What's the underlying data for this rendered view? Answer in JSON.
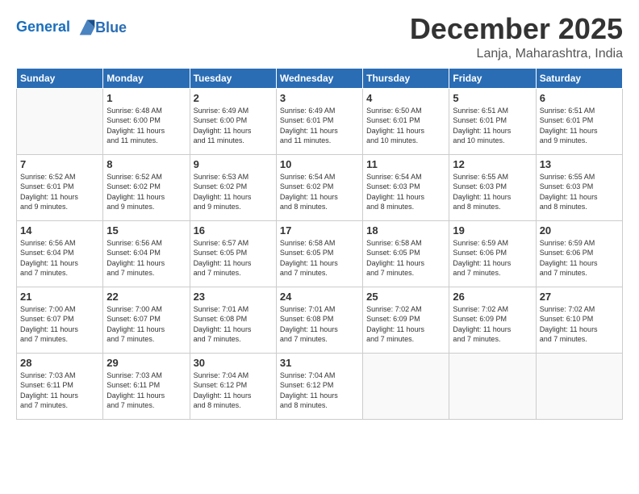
{
  "header": {
    "logo_line1": "General",
    "logo_line2": "Blue",
    "title": "December 2025",
    "location": "Lanja, Maharashtra, India"
  },
  "columns": [
    "Sunday",
    "Monday",
    "Tuesday",
    "Wednesday",
    "Thursday",
    "Friday",
    "Saturday"
  ],
  "weeks": [
    [
      {
        "day": "",
        "info": ""
      },
      {
        "day": "1",
        "info": "Sunrise: 6:48 AM\nSunset: 6:00 PM\nDaylight: 11 hours\nand 11 minutes."
      },
      {
        "day": "2",
        "info": "Sunrise: 6:49 AM\nSunset: 6:00 PM\nDaylight: 11 hours\nand 11 minutes."
      },
      {
        "day": "3",
        "info": "Sunrise: 6:49 AM\nSunset: 6:01 PM\nDaylight: 11 hours\nand 11 minutes."
      },
      {
        "day": "4",
        "info": "Sunrise: 6:50 AM\nSunset: 6:01 PM\nDaylight: 11 hours\nand 10 minutes."
      },
      {
        "day": "5",
        "info": "Sunrise: 6:51 AM\nSunset: 6:01 PM\nDaylight: 11 hours\nand 10 minutes."
      },
      {
        "day": "6",
        "info": "Sunrise: 6:51 AM\nSunset: 6:01 PM\nDaylight: 11 hours\nand 9 minutes."
      }
    ],
    [
      {
        "day": "7",
        "info": "Sunrise: 6:52 AM\nSunset: 6:01 PM\nDaylight: 11 hours\nand 9 minutes."
      },
      {
        "day": "8",
        "info": "Sunrise: 6:52 AM\nSunset: 6:02 PM\nDaylight: 11 hours\nand 9 minutes."
      },
      {
        "day": "9",
        "info": "Sunrise: 6:53 AM\nSunset: 6:02 PM\nDaylight: 11 hours\nand 9 minutes."
      },
      {
        "day": "10",
        "info": "Sunrise: 6:54 AM\nSunset: 6:02 PM\nDaylight: 11 hours\nand 8 minutes."
      },
      {
        "day": "11",
        "info": "Sunrise: 6:54 AM\nSunset: 6:03 PM\nDaylight: 11 hours\nand 8 minutes."
      },
      {
        "day": "12",
        "info": "Sunrise: 6:55 AM\nSunset: 6:03 PM\nDaylight: 11 hours\nand 8 minutes."
      },
      {
        "day": "13",
        "info": "Sunrise: 6:55 AM\nSunset: 6:03 PM\nDaylight: 11 hours\nand 8 minutes."
      }
    ],
    [
      {
        "day": "14",
        "info": "Sunrise: 6:56 AM\nSunset: 6:04 PM\nDaylight: 11 hours\nand 7 minutes."
      },
      {
        "day": "15",
        "info": "Sunrise: 6:56 AM\nSunset: 6:04 PM\nDaylight: 11 hours\nand 7 minutes."
      },
      {
        "day": "16",
        "info": "Sunrise: 6:57 AM\nSunset: 6:05 PM\nDaylight: 11 hours\nand 7 minutes."
      },
      {
        "day": "17",
        "info": "Sunrise: 6:58 AM\nSunset: 6:05 PM\nDaylight: 11 hours\nand 7 minutes."
      },
      {
        "day": "18",
        "info": "Sunrise: 6:58 AM\nSunset: 6:05 PM\nDaylight: 11 hours\nand 7 minutes."
      },
      {
        "day": "19",
        "info": "Sunrise: 6:59 AM\nSunset: 6:06 PM\nDaylight: 11 hours\nand 7 minutes."
      },
      {
        "day": "20",
        "info": "Sunrise: 6:59 AM\nSunset: 6:06 PM\nDaylight: 11 hours\nand 7 minutes."
      }
    ],
    [
      {
        "day": "21",
        "info": "Sunrise: 7:00 AM\nSunset: 6:07 PM\nDaylight: 11 hours\nand 7 minutes."
      },
      {
        "day": "22",
        "info": "Sunrise: 7:00 AM\nSunset: 6:07 PM\nDaylight: 11 hours\nand 7 minutes."
      },
      {
        "day": "23",
        "info": "Sunrise: 7:01 AM\nSunset: 6:08 PM\nDaylight: 11 hours\nand 7 minutes."
      },
      {
        "day": "24",
        "info": "Sunrise: 7:01 AM\nSunset: 6:08 PM\nDaylight: 11 hours\nand 7 minutes."
      },
      {
        "day": "25",
        "info": "Sunrise: 7:02 AM\nSunset: 6:09 PM\nDaylight: 11 hours\nand 7 minutes."
      },
      {
        "day": "26",
        "info": "Sunrise: 7:02 AM\nSunset: 6:09 PM\nDaylight: 11 hours\nand 7 minutes."
      },
      {
        "day": "27",
        "info": "Sunrise: 7:02 AM\nSunset: 6:10 PM\nDaylight: 11 hours\nand 7 minutes."
      }
    ],
    [
      {
        "day": "28",
        "info": "Sunrise: 7:03 AM\nSunset: 6:11 PM\nDaylight: 11 hours\nand 7 minutes."
      },
      {
        "day": "29",
        "info": "Sunrise: 7:03 AM\nSunset: 6:11 PM\nDaylight: 11 hours\nand 7 minutes."
      },
      {
        "day": "30",
        "info": "Sunrise: 7:04 AM\nSunset: 6:12 PM\nDaylight: 11 hours\nand 8 minutes."
      },
      {
        "day": "31",
        "info": "Sunrise: 7:04 AM\nSunset: 6:12 PM\nDaylight: 11 hours\nand 8 minutes."
      },
      {
        "day": "",
        "info": ""
      },
      {
        "day": "",
        "info": ""
      },
      {
        "day": "",
        "info": ""
      }
    ]
  ]
}
